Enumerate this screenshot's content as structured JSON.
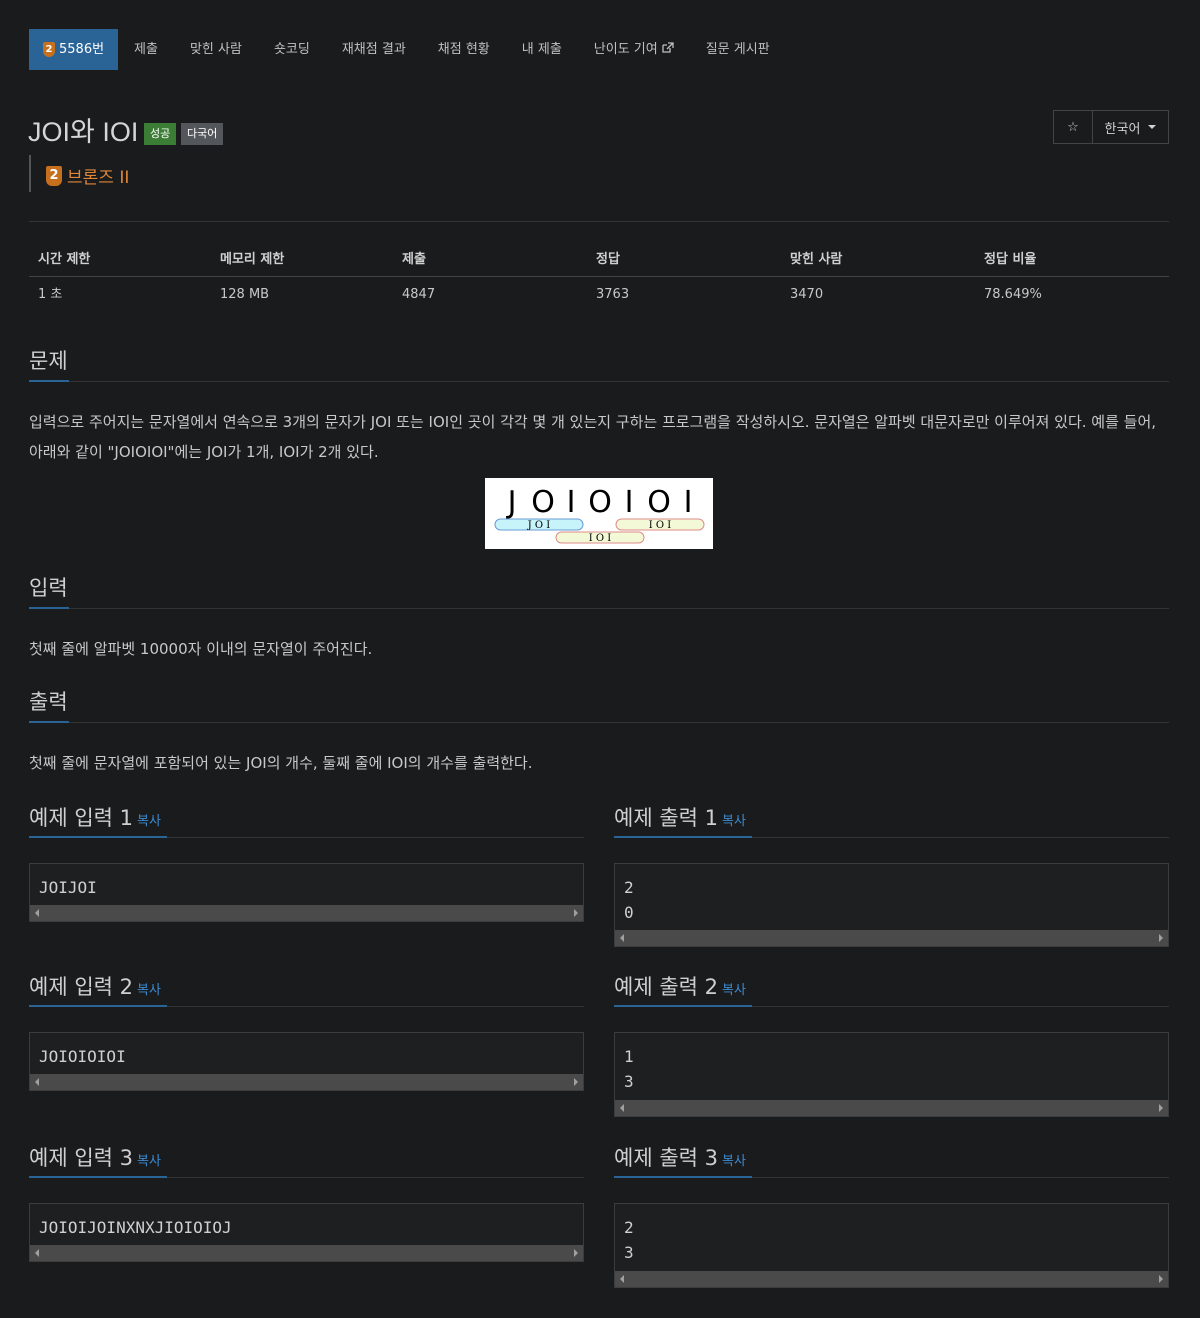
{
  "nav": {
    "problem_label": "5586번",
    "items": [
      "제출",
      "맞힌 사람",
      "숏코딩",
      "재채점 결과",
      "채점 현황",
      "내 제출",
      "난이도 기여",
      "질문 게시판"
    ]
  },
  "problem": {
    "title": "JOI와 IOI",
    "label_success": "성공",
    "label_lang": "다국어",
    "tier_number": "2",
    "tier_name": "브론즈 II",
    "language_select": "한국어"
  },
  "info": {
    "headers": [
      "시간 제한",
      "메모리 제한",
      "제출",
      "정답",
      "맞힌 사람",
      "정답 비율"
    ],
    "values": [
      "1 초",
      "128 MB",
      "4847",
      "3763",
      "3470",
      "78.649%"
    ]
  },
  "sections": {
    "problem_title": "문제",
    "problem_text": "입력으로 주어지는 문자열에서 연속으로 3개의 문자가 JOI 또는 IOI인 곳이 각각 몇 개 있는지 구하는 프로그램을 작성하시오. 문자열은 알파벳 대문자로만 이루어져 있다. 예를 들어, 아래와 같이 \"JOIOIOI\"에는 JOI가 1개, IOI가 2개 있다.",
    "input_title": "입력",
    "input_text": "첫째 줄에 알파벳 10000자 이내의 문자열이 주어진다.",
    "output_title": "출력",
    "output_text": "첫째 줄에 문자열에 포함되어 있는 JOI의 개수, 둘째 줄에 IOI의 개수를 출력한다."
  },
  "figure": {
    "letters": [
      "J",
      "O",
      "I",
      "O",
      "I",
      "O",
      "I"
    ],
    "pill_joi": "J O I",
    "pill_ioi_1": "I O I",
    "pill_ioi_2": "I O I"
  },
  "samples": {
    "copy_label": "복사",
    "input1_title": "예제 입력 1",
    "output1_title": "예제 출력 1",
    "input2_title": "예제 입력 2",
    "output2_title": "예제 출력 2",
    "input3_title": "예제 입력 3",
    "output3_title": "예제 출력 3",
    "input1": "JOIJOI",
    "output1": "2\n0",
    "input2": "JOIOIOIOI",
    "output2": "1\n3",
    "input3": "JOIOIJOINXNXJIOIOIOJ",
    "output3": "2\n3"
  },
  "colors": {
    "accent": "#2a6396",
    "success": "#3b7d35",
    "bronze": "#e0863a",
    "link": "#3d8ad0"
  }
}
